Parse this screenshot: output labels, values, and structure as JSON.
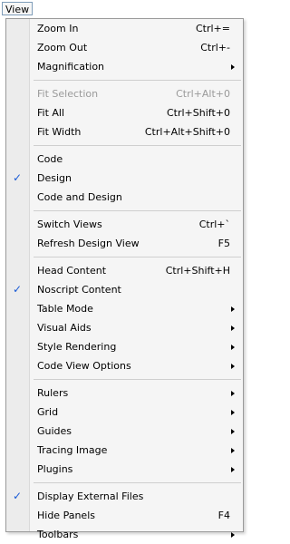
{
  "menubar": {
    "title": "View"
  },
  "colors": {
    "check": "#1a5bd6",
    "disabled": "#9a9a9a"
  },
  "menu": [
    {
      "type": "item",
      "label": "Zoom In",
      "shortcut": "Ctrl+="
    },
    {
      "type": "item",
      "label": "Zoom Out",
      "shortcut": "Ctrl+-"
    },
    {
      "type": "item",
      "label": "Magnification",
      "submenu": true
    },
    {
      "type": "separator"
    },
    {
      "type": "item",
      "label": "Fit Selection",
      "shortcut": "Ctrl+Alt+0",
      "disabled": true
    },
    {
      "type": "item",
      "label": "Fit All",
      "shortcut": "Ctrl+Shift+0"
    },
    {
      "type": "item",
      "label": "Fit Width",
      "shortcut": "Ctrl+Alt+Shift+0"
    },
    {
      "type": "separator"
    },
    {
      "type": "item",
      "label": "Code"
    },
    {
      "type": "item",
      "label": "Design",
      "checked": true
    },
    {
      "type": "item",
      "label": "Code and Design"
    },
    {
      "type": "separator"
    },
    {
      "type": "item",
      "label": "Switch Views",
      "shortcut": "Ctrl+`"
    },
    {
      "type": "item",
      "label": "Refresh Design View",
      "shortcut": "F5"
    },
    {
      "type": "separator"
    },
    {
      "type": "item",
      "label": "Head Content",
      "shortcut": "Ctrl+Shift+H"
    },
    {
      "type": "item",
      "label": "Noscript Content",
      "checked": true
    },
    {
      "type": "item",
      "label": "Table Mode",
      "submenu": true
    },
    {
      "type": "item",
      "label": "Visual Aids",
      "submenu": true
    },
    {
      "type": "item",
      "label": "Style Rendering",
      "submenu": true
    },
    {
      "type": "item",
      "label": "Code View Options",
      "submenu": true
    },
    {
      "type": "separator"
    },
    {
      "type": "item",
      "label": "Rulers",
      "submenu": true
    },
    {
      "type": "item",
      "label": "Grid",
      "submenu": true
    },
    {
      "type": "item",
      "label": "Guides",
      "submenu": true
    },
    {
      "type": "item",
      "label": "Tracing Image",
      "submenu": true
    },
    {
      "type": "item",
      "label": "Plugins",
      "submenu": true
    },
    {
      "type": "separator"
    },
    {
      "type": "item",
      "label": "Display External Files",
      "checked": true
    },
    {
      "type": "item",
      "label": "Hide Panels",
      "shortcut": "F4"
    },
    {
      "type": "item",
      "label": "Toolbars",
      "submenu": true
    }
  ]
}
